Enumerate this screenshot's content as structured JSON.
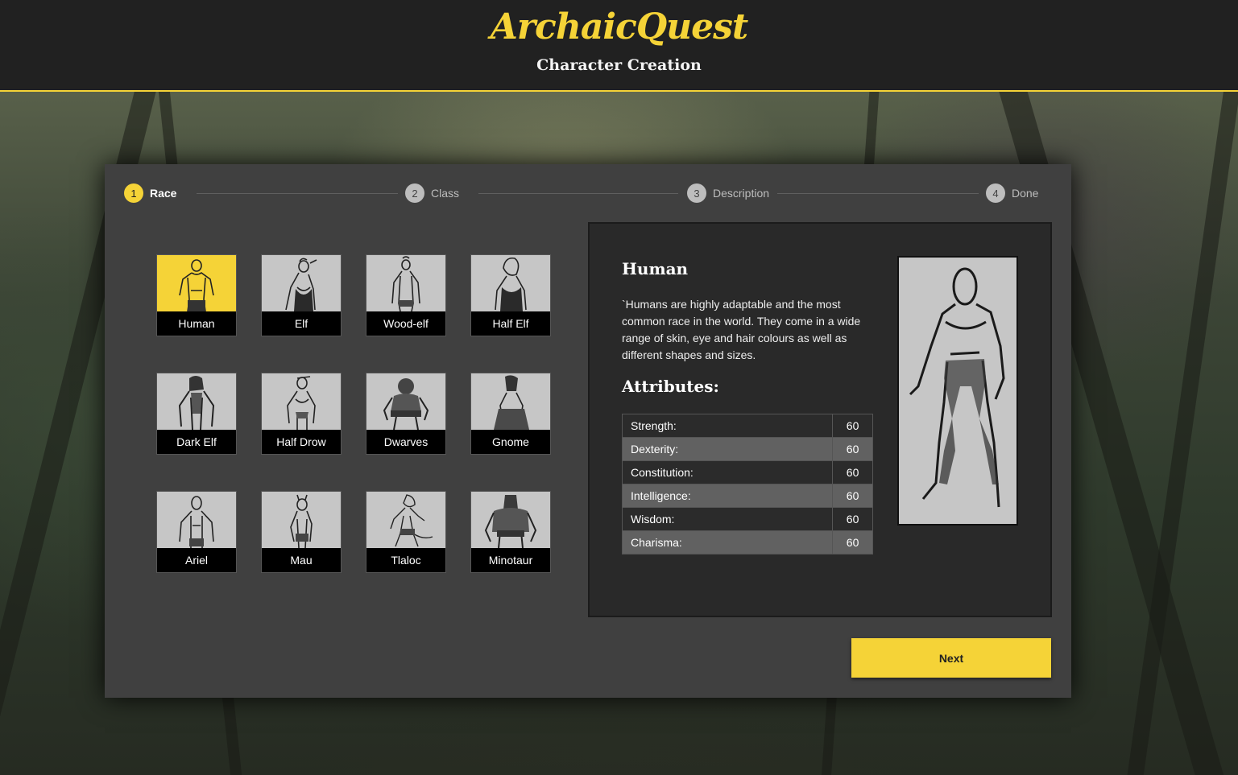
{
  "header": {
    "logo": "ArchaicQuest",
    "subtitle": "Character Creation"
  },
  "stepper": {
    "steps": [
      {
        "num": "1",
        "label": "Race",
        "active": true
      },
      {
        "num": "2",
        "label": "Class",
        "active": false
      },
      {
        "num": "3",
        "label": "Description",
        "active": false
      },
      {
        "num": "4",
        "label": "Done",
        "active": false
      }
    ]
  },
  "races": [
    {
      "name": "Human",
      "selected": true
    },
    {
      "name": "Elf",
      "selected": false
    },
    {
      "name": "Wood-elf",
      "selected": false
    },
    {
      "name": "Half Elf",
      "selected": false
    },
    {
      "name": "Dark Elf",
      "selected": false
    },
    {
      "name": "Half Drow",
      "selected": false
    },
    {
      "name": "Dwarves",
      "selected": false
    },
    {
      "name": "Gnome",
      "selected": false
    },
    {
      "name": "Ariel",
      "selected": false
    },
    {
      "name": "Mau",
      "selected": false
    },
    {
      "name": "Tlaloc",
      "selected": false
    },
    {
      "name": "Minotaur",
      "selected": false
    }
  ],
  "detail": {
    "title": "Human",
    "description": "`Humans are highly adaptable and the most common race in the world. They come in a wide range of skin, eye and hair colours as well as different shapes and sizes.",
    "attributes_heading": "Attributes:",
    "attributes": [
      {
        "name": "Strength:",
        "value": "60"
      },
      {
        "name": "Dexterity:",
        "value": "60"
      },
      {
        "name": "Constitution:",
        "value": "60"
      },
      {
        "name": "Intelligence:",
        "value": "60"
      },
      {
        "name": "Wisdom:",
        "value": "60"
      },
      {
        "name": "Charisma:",
        "value": "60"
      }
    ]
  },
  "actions": {
    "next_label": "Next"
  },
  "colors": {
    "accent": "#f5d337",
    "header_bg": "#212121",
    "card_bg": "#404040"
  }
}
